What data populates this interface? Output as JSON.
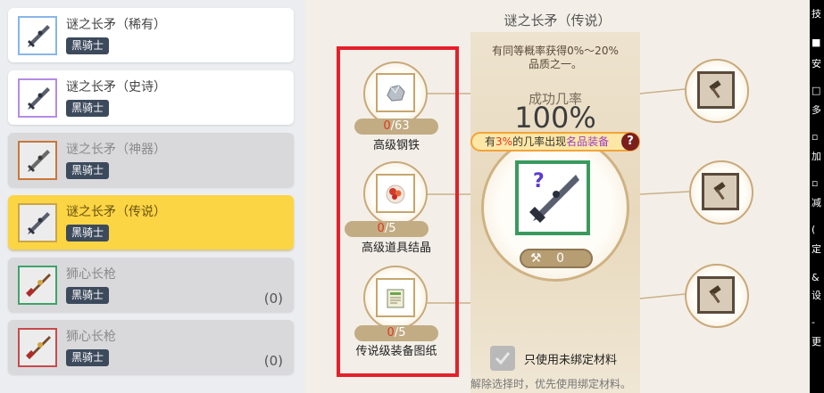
{
  "list": {
    "items": [
      {
        "name": "谜之长矛（稀有）",
        "tag": "黑骑士",
        "count": ""
      },
      {
        "name": "谜之长矛（史诗）",
        "tag": "黑骑士",
        "count": ""
      },
      {
        "name": "谜之长矛（神器）",
        "tag": "黑骑士",
        "count": ""
      },
      {
        "name": "谜之长矛（传说）",
        "tag": "黑骑士",
        "count": ""
      },
      {
        "name": "狮心长枪",
        "tag": "黑骑士",
        "count": "(0)"
      },
      {
        "name": "狮心长枪",
        "tag": "黑骑士",
        "count": "(0)"
      }
    ]
  },
  "panel": {
    "title": "谜之长矛（传说）",
    "desc_line1": "有同等概率获得0%～20%",
    "desc_line2": "品质之一。",
    "rate_label": "成功几率",
    "rate_value": "100%",
    "banner_pre": "有",
    "banner_pct": "3%",
    "banner_mid": "的几率出现",
    "banner_acc": "名品装备",
    "help": "?",
    "hammer_count": "0",
    "materials": [
      {
        "have": "0",
        "need": "/63",
        "name": "高级钢铁",
        "icon": "ore-icon"
      },
      {
        "have": "0",
        "need": "/5",
        "name": "高级道具结晶",
        "icon": "crystal-icon"
      },
      {
        "have": "0",
        "need": "/5",
        "name": "传说级装备图纸",
        "icon": "scroll-icon"
      }
    ],
    "checkbox_label": "只使用未绑定材料",
    "note": "解除选择时，优先使用绑定材料。"
  },
  "strip": {
    "chars": [
      "技",
      "■",
      "安",
      "□",
      "多",
      "▫",
      "加",
      "▫",
      "减",
      "(",
      "定",
      "&",
      "设",
      "-",
      "更"
    ]
  },
  "colors": {
    "selected": "#fbd544",
    "highlight_box": "#e4202a",
    "material_have": "#e0381c"
  }
}
